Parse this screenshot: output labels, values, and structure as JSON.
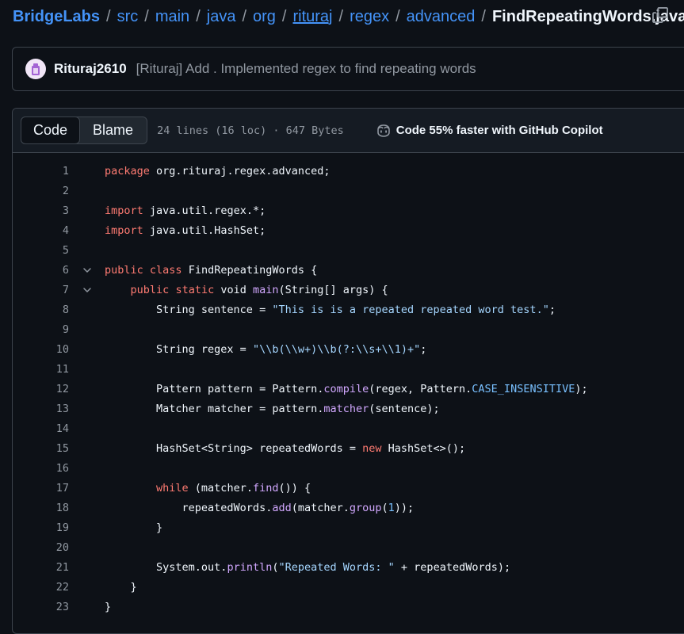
{
  "breadcrumb": {
    "root": "BridgeLabs",
    "separator": "/",
    "segments": [
      "src",
      "main",
      "java",
      "org",
      "rituraj",
      "regex",
      "advanced"
    ],
    "file": "FindRepeatingWords.java"
  },
  "commit": {
    "author": "Rituraj2610",
    "message": "[Rituraj] Add . Implemented regex to find repeating words"
  },
  "toolbar": {
    "code_tab": "Code",
    "blame_tab": "Blame",
    "file_info": "24 lines (16 loc) · 647 Bytes",
    "copilot_text": "Code 55% faster with GitHub Copilot"
  },
  "colors": {
    "keyword": "#ff7b72",
    "string": "#a5d6ff",
    "function": "#d2a8ff",
    "constant": "#79c0ff",
    "link": "#4493f8"
  },
  "icons": {
    "copy": "copy-icon",
    "avatar": "avatar-icon",
    "copilot": "copilot-icon",
    "fold": "chevron-down-icon"
  },
  "code_lines": [
    {
      "n": "1",
      "fold": false,
      "tokens": [
        {
          "t": "kw",
          "v": "package"
        },
        {
          "t": "tx",
          "v": " org.rituraj.regex.advanced;"
        }
      ]
    },
    {
      "n": "2",
      "fold": false,
      "tokens": []
    },
    {
      "n": "3",
      "fold": false,
      "tokens": [
        {
          "t": "kw",
          "v": "import"
        },
        {
          "t": "tx",
          "v": " java.util.regex.*;"
        }
      ]
    },
    {
      "n": "4",
      "fold": false,
      "tokens": [
        {
          "t": "kw",
          "v": "import"
        },
        {
          "t": "tx",
          "v": " java.util.HashSet;"
        }
      ]
    },
    {
      "n": "5",
      "fold": false,
      "tokens": []
    },
    {
      "n": "6",
      "fold": true,
      "tokens": [
        {
          "t": "kw",
          "v": "public"
        },
        {
          "t": "tx",
          "v": " "
        },
        {
          "t": "kw",
          "v": "class"
        },
        {
          "t": "tx",
          "v": " FindRepeatingWords {"
        }
      ]
    },
    {
      "n": "7",
      "fold": true,
      "tokens": [
        {
          "t": "tx",
          "v": "    "
        },
        {
          "t": "kw",
          "v": "public"
        },
        {
          "t": "tx",
          "v": " "
        },
        {
          "t": "kw",
          "v": "static"
        },
        {
          "t": "tx",
          "v": " void "
        },
        {
          "t": "fn",
          "v": "main"
        },
        {
          "t": "tx",
          "v": "(String[] args) {"
        }
      ]
    },
    {
      "n": "8",
      "fold": false,
      "tokens": [
        {
          "t": "tx",
          "v": "        String sentence = "
        },
        {
          "t": "str",
          "v": "\"This is is a repeated repeated word test.\""
        },
        {
          "t": "tx",
          "v": ";"
        }
      ]
    },
    {
      "n": "9",
      "fold": false,
      "tokens": []
    },
    {
      "n": "10",
      "fold": false,
      "tokens": [
        {
          "t": "tx",
          "v": "        String regex = "
        },
        {
          "t": "str",
          "v": "\"\\\\b(\\\\w+)\\\\b(?:\\\\s+\\\\1)+\""
        },
        {
          "t": "tx",
          "v": ";"
        }
      ]
    },
    {
      "n": "11",
      "fold": false,
      "tokens": []
    },
    {
      "n": "12",
      "fold": false,
      "tokens": [
        {
          "t": "tx",
          "v": "        Pattern pattern = Pattern."
        },
        {
          "t": "fn",
          "v": "compile"
        },
        {
          "t": "tx",
          "v": "(regex, Pattern."
        },
        {
          "t": "cn",
          "v": "CASE_INSENSITIVE"
        },
        {
          "t": "tx",
          "v": ");"
        }
      ]
    },
    {
      "n": "13",
      "fold": false,
      "tokens": [
        {
          "t": "tx",
          "v": "        Matcher matcher = pattern."
        },
        {
          "t": "fn",
          "v": "matcher"
        },
        {
          "t": "tx",
          "v": "(sentence);"
        }
      ]
    },
    {
      "n": "14",
      "fold": false,
      "tokens": []
    },
    {
      "n": "15",
      "fold": false,
      "tokens": [
        {
          "t": "tx",
          "v": "        HashSet<String> repeatedWords = "
        },
        {
          "t": "kw",
          "v": "new"
        },
        {
          "t": "tx",
          "v": " HashSet<>();"
        }
      ]
    },
    {
      "n": "16",
      "fold": false,
      "tokens": []
    },
    {
      "n": "17",
      "fold": false,
      "tokens": [
        {
          "t": "tx",
          "v": "        "
        },
        {
          "t": "kw",
          "v": "while"
        },
        {
          "t": "tx",
          "v": " (matcher."
        },
        {
          "t": "fn",
          "v": "find"
        },
        {
          "t": "tx",
          "v": "()) {"
        }
      ]
    },
    {
      "n": "18",
      "fold": false,
      "tokens": [
        {
          "t": "tx",
          "v": "            repeatedWords."
        },
        {
          "t": "fn",
          "v": "add"
        },
        {
          "t": "tx",
          "v": "(matcher."
        },
        {
          "t": "fn",
          "v": "group"
        },
        {
          "t": "tx",
          "v": "("
        },
        {
          "t": "cn",
          "v": "1"
        },
        {
          "t": "tx",
          "v": "));"
        }
      ]
    },
    {
      "n": "19",
      "fold": false,
      "tokens": [
        {
          "t": "tx",
          "v": "        }"
        }
      ]
    },
    {
      "n": "20",
      "fold": false,
      "tokens": []
    },
    {
      "n": "21",
      "fold": false,
      "tokens": [
        {
          "t": "tx",
          "v": "        System.out."
        },
        {
          "t": "fn",
          "v": "println"
        },
        {
          "t": "tx",
          "v": "("
        },
        {
          "t": "str",
          "v": "\"Repeated Words: \""
        },
        {
          "t": "tx",
          "v": " + repeatedWords);"
        }
      ]
    },
    {
      "n": "22",
      "fold": false,
      "tokens": [
        {
          "t": "tx",
          "v": "    }"
        }
      ]
    },
    {
      "n": "23",
      "fold": false,
      "tokens": [
        {
          "t": "tx",
          "v": "}"
        }
      ]
    }
  ]
}
